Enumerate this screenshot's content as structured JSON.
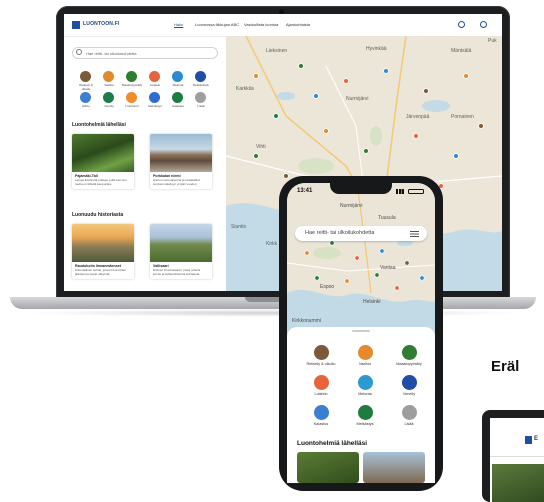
{
  "laptop": {
    "logo_text": "LUONTOON.FI",
    "nav": [
      "Haku",
      "Luonnossa liikkujan ABC",
      "Vastuullista luontoa",
      "Ajankohtaista"
    ],
    "search_placeholder": "Hae reitti- tai ulkoilukohdetta",
    "categories": [
      {
        "label": "Retkeily & ulkoilu",
        "color": "#7b5a3a",
        "icon": "hiker-icon"
      },
      {
        "label": "Vaellus",
        "color": "#e28a2c",
        "icon": "tent-icon"
      },
      {
        "label": "Maastopyöräily",
        "color": "#2e7d32",
        "icon": "bike-icon"
      },
      {
        "label": "Luistelu",
        "color": "#e8623c",
        "icon": "skate-icon"
      },
      {
        "label": "Melonta",
        "color": "#2b8ad3",
        "icon": "kayak-icon"
      },
      {
        "label": "Retkiluistelu",
        "color": "#1f4da8",
        "icon": "anchor-icon"
      },
      {
        "label": "Hiihto",
        "color": "#3b7fd0",
        "icon": "ski-icon"
      },
      {
        "label": "Veneily",
        "color": "#1d7c4a",
        "icon": "compass-icon"
      },
      {
        "label": "Lintutornit",
        "color": "#f28c28",
        "icon": "bird-icon"
      },
      {
        "label": "Metsästys",
        "color": "#2f6ed0",
        "icon": "boat-icon"
      },
      {
        "label": "Kalastus",
        "color": "#1d7c3f",
        "icon": "fish-icon"
      },
      {
        "label": "Lisää",
        "color": "#9e9e9e",
        "icon": "more-icon"
      }
    ],
    "nearby_heading": "Luontohelmiä lähelläsi",
    "cards_nearby": [
      {
        "title": "Pajamäki-Tali",
        "desc": "Lepoja ikivihreitä polkuja, joilla luonnon rauha on lähellä kaupunkia."
      },
      {
        "title": "Porkkalan niemi",
        "desc": "Hienot merimaisemat ja rantakalliot sopivat retkeilyyn ympäri vuoden."
      }
    ],
    "history_heading": "Luonuudu historiasta",
    "cards_history": [
      {
        "title": "Rauduholm linnanmäenset",
        "desc": "Historiallinen kohde, jossa linnanmäen jäänteet ja upeat näkymät."
      },
      {
        "title": "Vallisaari",
        "desc": "Entinen linnoitussaari, jossa rehevä luonto ja kulttuurihistoria kohtaavat."
      }
    ],
    "map_labels": [
      "Lieksinen",
      "Hyvinkää",
      "Mäntsälä",
      "Puk",
      "Karkkila",
      "Nurmijärvi",
      "Järvenpää",
      "Pornainen",
      "Vihti",
      "Espoo",
      "Vantaa",
      "Siuntio",
      "Kirkk"
    ]
  },
  "phone": {
    "time": "13:41",
    "search_placeholder": "Hae reitti- tai ulkoilukohdetta",
    "map_labels": [
      "Nurmijärvi",
      "Tuusula",
      "Vantaa",
      "Espoo",
      "Helsinki",
      "Kirkkonummi"
    ],
    "categories": [
      {
        "label": "Retkeily & ulkoilu",
        "color": "#7b5a3a",
        "icon": "hiker-icon"
      },
      {
        "label": "Vaellus",
        "color": "#e28a2c",
        "icon": "tent-icon"
      },
      {
        "label": "Maastopyöräily",
        "color": "#2e7d32",
        "icon": "bike-icon"
      },
      {
        "label": "Luistelu",
        "color": "#e8623c",
        "icon": "skate-icon"
      },
      {
        "label": "Melonta",
        "color": "#2b9ad3",
        "icon": "kayak-icon"
      },
      {
        "label": "Veneily",
        "color": "#1f4da8",
        "icon": "anchor-icon"
      },
      {
        "label": "Kalastus",
        "color": "#3b7fd0",
        "icon": "fish-icon"
      },
      {
        "label": "Metsästys",
        "color": "#1d7c3f",
        "icon": "compass-icon"
      },
      {
        "label": "Lisää",
        "color": "#9e9e9e",
        "icon": "more-icon"
      }
    ],
    "nearby_heading": "Luontohelmiä lähelläsi"
  },
  "tablet": {
    "heading": "Eräl",
    "logo_text": "E"
  }
}
